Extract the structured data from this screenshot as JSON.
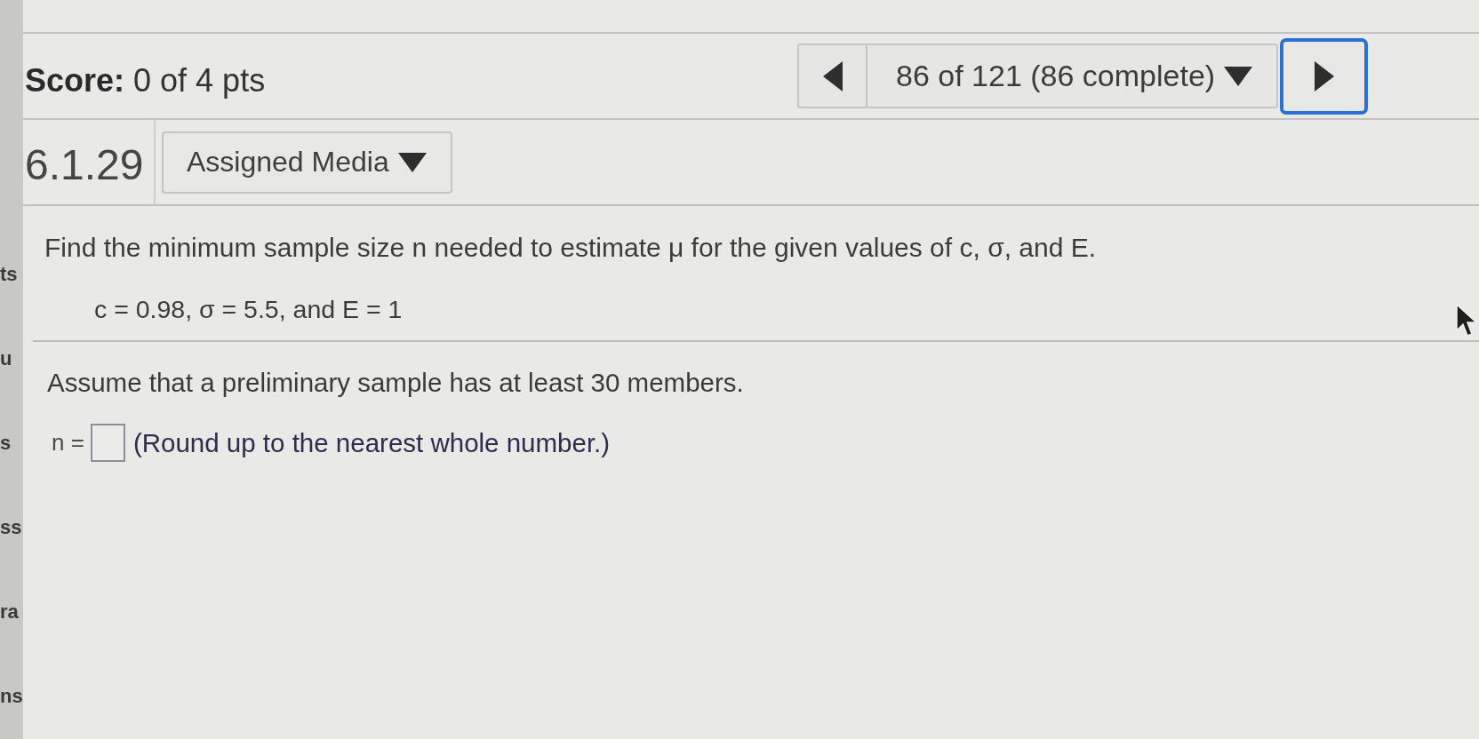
{
  "score": "**Score:** 0 of 4 pts",
  "navigation": {
    "position": "86 of 121 (86 complete)",
    "next_focused": true
  },
  "question": {
    "number": "6.1.29",
    "media_button": "Assigned Media",
    "prompt": "Find the minimum sample size n needed to estimate μ for the given values of c, σ, and E.",
    "given": "c = 0.98, σ = 5.5, and E = 1",
    "assumption": "Assume that a preliminary sample has at least 30 members.",
    "answer": {
      "label": "n =",
      "hint": "(Round up to the nearest whole number.)"
    }
  },
  "sidebar_fragments": [
    "ts",
    "u",
    "s",
    "ss",
    "ra",
    "ns"
  ]
}
